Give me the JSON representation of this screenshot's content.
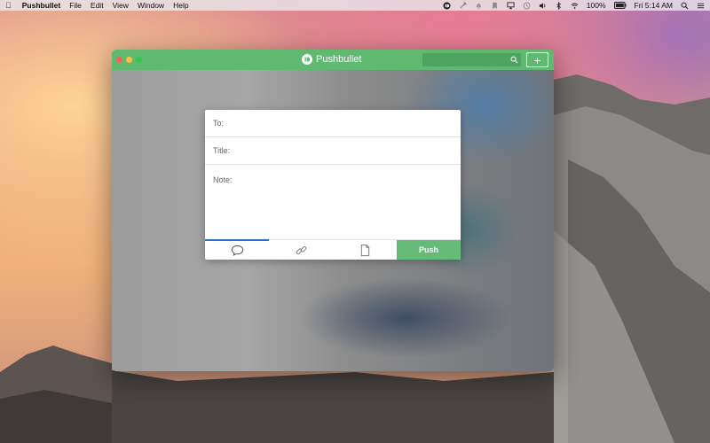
{
  "menubar": {
    "app_name": "Pushbullet",
    "menus": [
      "File",
      "Edit",
      "View",
      "Window",
      "Help"
    ],
    "status": {
      "battery": "100%",
      "clock": "Fri 5:14 AM"
    }
  },
  "window": {
    "title": "Pushbullet",
    "search_placeholder": "",
    "add_label": "+"
  },
  "compose": {
    "to_label": "To:",
    "title_label": "Title:",
    "note_label": "Note:",
    "tabs": [
      {
        "icon": "speech-bubble-icon",
        "active": true
      },
      {
        "icon": "link-icon",
        "active": false
      },
      {
        "icon": "file-icon",
        "active": false
      }
    ],
    "push_label": "Push"
  },
  "colors": {
    "brand_green": "#5fb970",
    "push_green": "#66bb78",
    "active_tab": "#2a6fd0"
  }
}
